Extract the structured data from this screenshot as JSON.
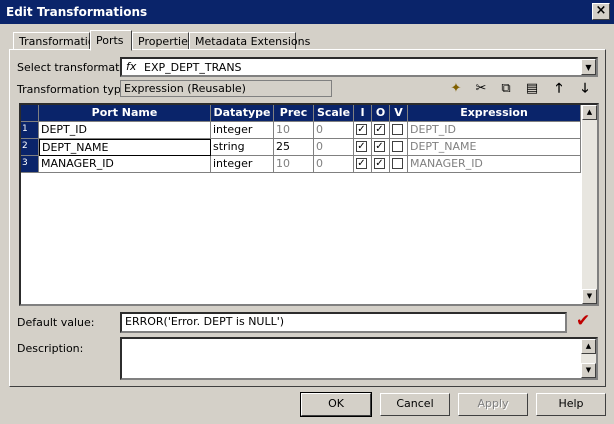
{
  "window": {
    "title": "Edit Transformations",
    "close": "×"
  },
  "tabs": [
    {
      "label": "Transformation"
    },
    {
      "label": "Ports"
    },
    {
      "label": "Properties"
    },
    {
      "label": "Metadata Extensions"
    }
  ],
  "select_transformation": {
    "label": "Select transformation:",
    "icon": "fx",
    "value": "EXP_DEPT_TRANS"
  },
  "transformation_type": {
    "label": "Transformation type:",
    "value": "Expression (Reusable)"
  },
  "toolbar_icons": [
    "new-port-icon",
    "cut-icon",
    "copy-icon",
    "paste-icon",
    "move-up-icon",
    "move-down-icon"
  ],
  "grid": {
    "columns": [
      "Port Name",
      "Datatype",
      "Prec",
      "Scale",
      "I",
      "O",
      "V",
      "Expression"
    ],
    "rows": [
      {
        "num": "1",
        "port": "DEPT_ID",
        "datatype": "integer",
        "prec": "10",
        "scale": "0",
        "i": true,
        "o": true,
        "v": false,
        "expr": "DEPT_ID"
      },
      {
        "num": "2",
        "port": "DEPT_NAME",
        "datatype": "string",
        "prec": "25",
        "scale": "0",
        "i": true,
        "o": true,
        "v": false,
        "expr": "DEPT_NAME"
      },
      {
        "num": "3",
        "port": "MANAGER_ID",
        "datatype": "integer",
        "prec": "10",
        "scale": "0",
        "i": true,
        "o": true,
        "v": false,
        "expr": "MANAGER_ID"
      }
    ]
  },
  "default_value": {
    "label": "Default value:",
    "value": "ERROR('Error. DEPT is NULL')",
    "validate_icon": "✔"
  },
  "description": {
    "label": "Description:",
    "value": ""
  },
  "buttons": {
    "ok": "OK",
    "cancel": "Cancel",
    "apply": "Apply",
    "help": "Help"
  },
  "colors": {
    "header_bg": "#0a246a",
    "dialog_bg": "#d4d0c8",
    "validate_mark": "#c00000"
  }
}
